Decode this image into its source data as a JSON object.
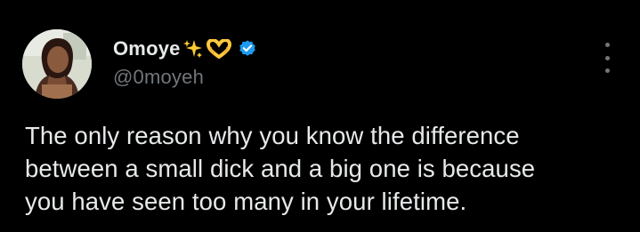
{
  "tweet": {
    "author": {
      "display_name": "Omoye",
      "emojis": [
        "sparkles-icon",
        "heart-hands-icon"
      ],
      "handle": "@0moyeh",
      "verified": true,
      "verified_color": "#1d9bf0"
    },
    "text_lines": [
      "The only reason why you know the difference",
      "between a small dick and a big one is because",
      "you have seen too many in your lifetime."
    ],
    "more_icon": "more-vertical-icon"
  },
  "colors": {
    "background": "#000000",
    "text_primary": "#e7e9ea",
    "text_secondary": "#71767b",
    "accent": "#1d9bf0"
  }
}
